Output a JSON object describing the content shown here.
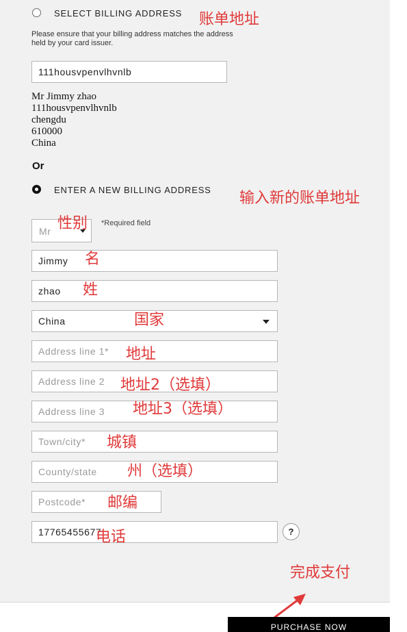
{
  "billing": {
    "select_label": "SELECT BILLING ADDRESS",
    "note": "Please ensure that your billing address matches the address held by your card issuer.",
    "saved_select_value": "111housvpenvlhvnlb",
    "address_lines": [
      "Mr Jimmy zhao",
      "111housvpenvlhvnlb",
      "chengdu",
      "610000",
      "China"
    ],
    "or_label": "Or",
    "new_label": "ENTER A NEW BILLING ADDRESS",
    "required_note": "*Required field"
  },
  "form": {
    "title_value": "Mr",
    "first_name": "Jimmy",
    "last_name": "zhao",
    "country": "China",
    "address1_placeholder": "Address line 1*",
    "address2_placeholder": "Address line 2",
    "address3_placeholder": "Address line 3",
    "town_placeholder": "Town/city*",
    "county_placeholder": "County/state",
    "postcode_placeholder": "Postcode*",
    "phone": "17765455677",
    "help_label": "?"
  },
  "purchase_label": "PURCHASE NOW",
  "annotations": {
    "billing_address": "账单地址",
    "new_billing_address": "输入新的账单地址",
    "gender": "性别",
    "first_name": "名",
    "last_name": "姓",
    "country": "国家",
    "address": "地址",
    "address2": "地址2（选填）",
    "address3": "地址3（选填）",
    "town": "城镇",
    "state": "州（选填）",
    "postcode": "邮编",
    "phone": "电话",
    "complete_payment": "完成支付"
  },
  "colors": {
    "annotation": "#e03a3a",
    "panel_background": "#f1f1f1",
    "button_background": "#000000"
  }
}
